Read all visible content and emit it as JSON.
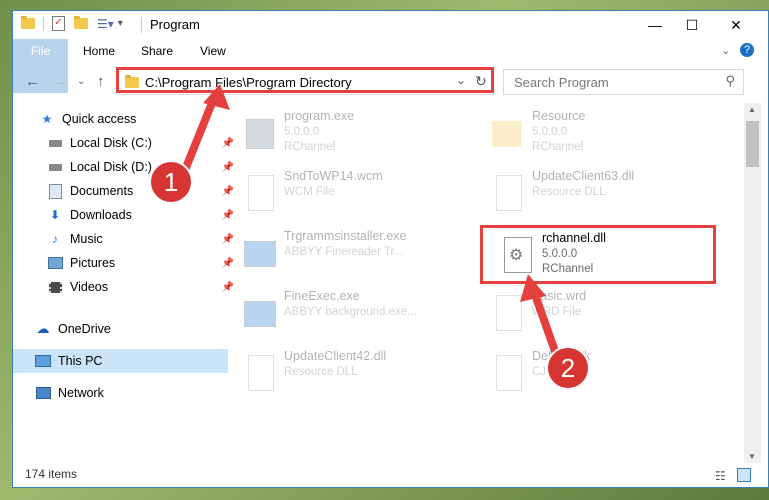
{
  "window": {
    "title": "Program"
  },
  "ribbon": {
    "tabs": [
      "File",
      "Home",
      "Share",
      "View"
    ]
  },
  "address": {
    "path": "C:\\Program Files\\Program Directory"
  },
  "search": {
    "placeholder": "Search Program"
  },
  "sidebar": {
    "items": [
      {
        "label": "Quick access",
        "icon": "star-icon"
      },
      {
        "label": "Local Disk (C:)",
        "icon": "drive-icon"
      },
      {
        "label": "Local Disk (D:)",
        "icon": "drive-icon"
      },
      {
        "label": "Documents",
        "icon": "documents-icon"
      },
      {
        "label": "Downloads",
        "icon": "download-icon"
      },
      {
        "label": "Music",
        "icon": "music-icon"
      },
      {
        "label": "Pictures",
        "icon": "pictures-icon"
      },
      {
        "label": "Videos",
        "icon": "videos-icon"
      },
      {
        "label": "OneDrive",
        "icon": "cloud-icon"
      },
      {
        "label": "This PC",
        "icon": "pc-icon"
      },
      {
        "label": "Network",
        "icon": "network-icon"
      }
    ]
  },
  "files": [
    {
      "name": "program.exe",
      "line1": "5.0.0.0",
      "line2": "RChannel"
    },
    {
      "name": "Resource",
      "line1": "5.0.0.0",
      "line2": "RChannel"
    },
    {
      "name": "SndToWP14.wcm",
      "line1": "WCM File",
      "line2": ""
    },
    {
      "name": "UpdateClient63.dll",
      "line1": "Resource DLL",
      "line2": ""
    },
    {
      "name": "Trgrammsinstaller.exe",
      "line1": "ABBYY Finereader Tr...",
      "line2": ""
    },
    {
      "name": "rchannel.dll",
      "line1": "5.0.0.0",
      "line2": "RChannel"
    },
    {
      "name": "FineExec.exe",
      "line1": "ABBYY background.exe...",
      "line2": ""
    },
    {
      "name": "Basic.wrd",
      "line1": "WRD File",
      "line2": ""
    },
    {
      "name": "UpdateClient42.dll",
      "line1": "Resource DLL",
      "line2": ""
    },
    {
      "name": "Default.cjk",
      "line1": "CJK File",
      "line2": ""
    }
  ],
  "status": {
    "count": "174 items"
  },
  "annotations": {
    "step1": "1",
    "step2": "2"
  },
  "colors": {
    "accent": "#1a6fc4",
    "highlight": "#e4403d",
    "selected": "#cce4f7"
  }
}
